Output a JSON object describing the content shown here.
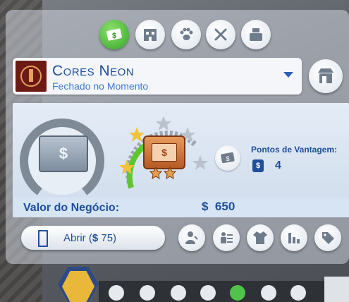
{
  "categories": [
    {
      "name": "retail-money-icon",
      "active": true
    },
    {
      "name": "building-icon",
      "active": false
    },
    {
      "name": "paw-icon",
      "active": false
    },
    {
      "name": "utensils-icon",
      "active": false
    },
    {
      "name": "cash-register-icon",
      "active": false
    }
  ],
  "business": {
    "name": "Cores Neon",
    "status": "Fechado no Momento"
  },
  "perks": {
    "label": "Pontos de Vantagem:",
    "value": "4"
  },
  "business_value": {
    "label": "Valor do Negócio:",
    "amount": "650"
  },
  "open_button": {
    "label": "Abrir (",
    "amount": "75",
    "suffix": ")"
  },
  "management_buttons": [
    "manage-employees-icon",
    "business-report-icon",
    "uniform-icon",
    "sales-chart-icon",
    "price-tag-icon"
  ],
  "star_rating": {
    "filled": 2,
    "total": 5
  },
  "colors": {
    "accent": "#1f4e9c",
    "active_green": "#33a52a",
    "bronze": "#b55a24"
  }
}
